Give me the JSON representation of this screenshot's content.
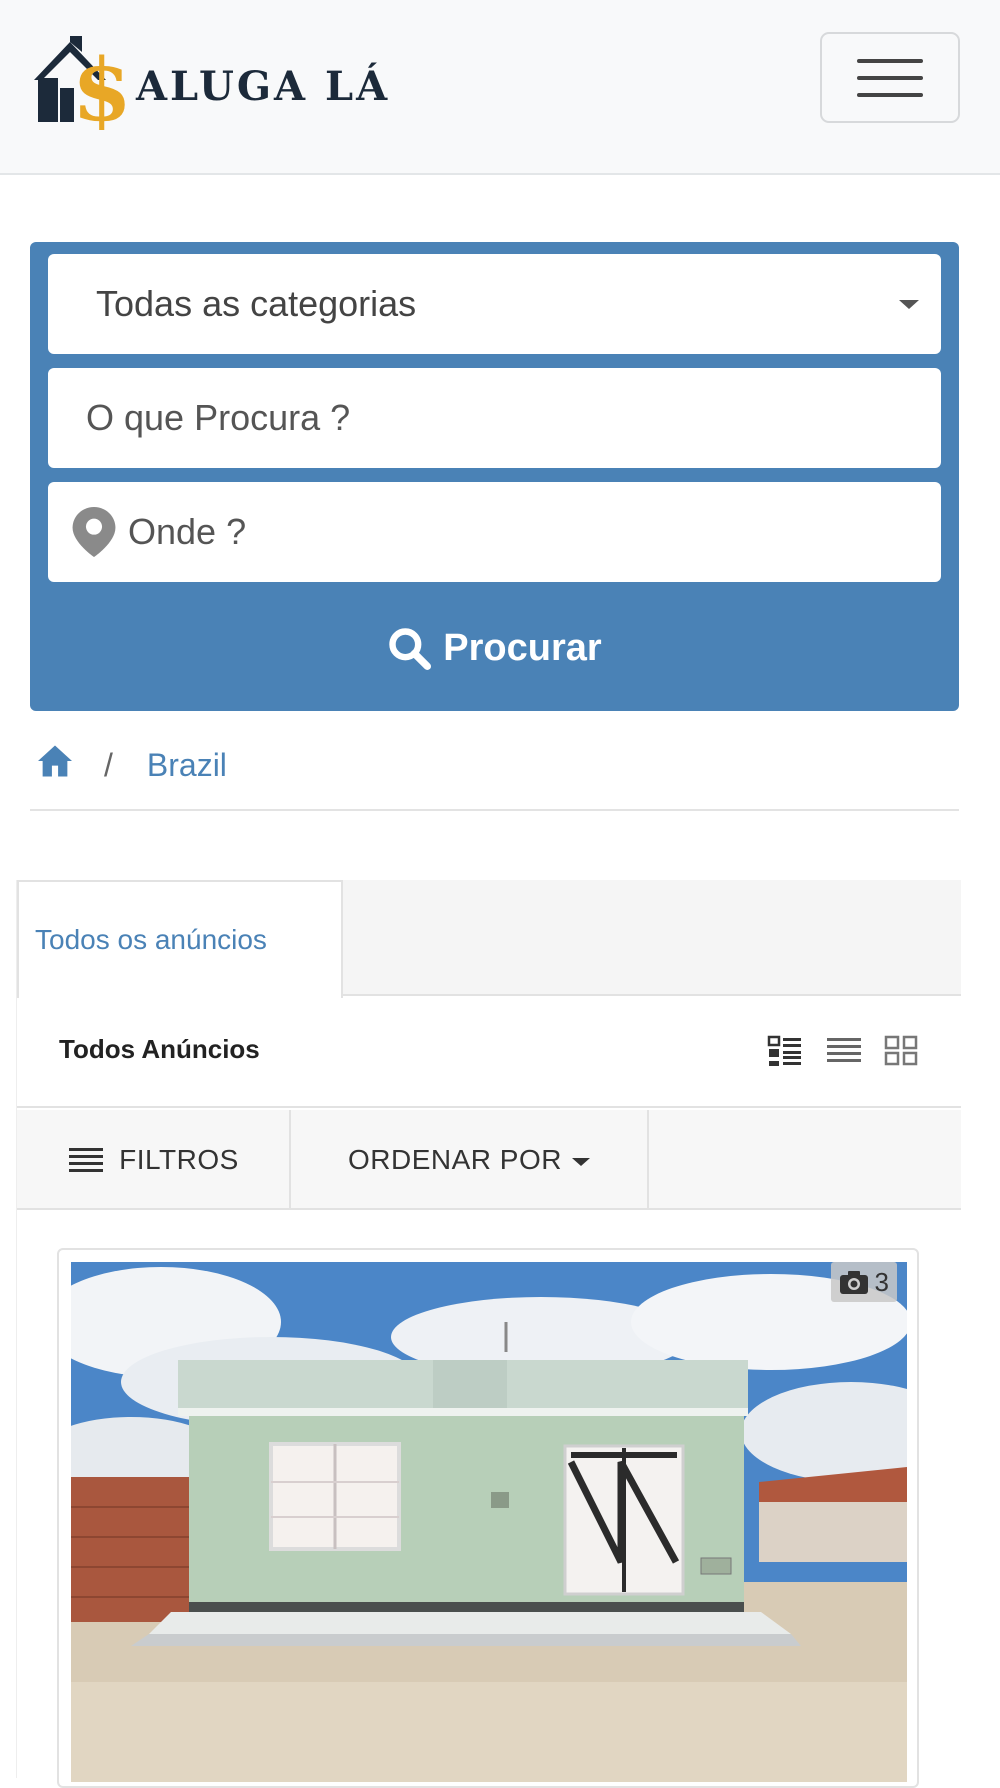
{
  "brand": {
    "name": "ALUGA LÁ",
    "logo_icon": "house-dollar-logo"
  },
  "navbar": {
    "menu_icon": "hamburger-menu-icon"
  },
  "search": {
    "category_selected": "Todas as categorias",
    "query_placeholder": "O que Procura ?",
    "location_placeholder": "Onde ?",
    "submit_label": "Procurar",
    "box_color": "#4a82b6"
  },
  "breadcrumb": {
    "home_icon": "home-icon",
    "separator": "/",
    "current": "Brazil"
  },
  "tabs": [
    {
      "label": "Todos os anúncios",
      "active": true
    }
  ],
  "listing_header": {
    "title": "Todos Anúncios",
    "view_icons": [
      "compact-list-icon",
      "list-view-icon",
      "grid-view-icon"
    ]
  },
  "filter_bar": {
    "filters_label": "FILTROS",
    "order_label": "ORDENAR POR"
  },
  "listings": [
    {
      "photo_count": "3",
      "photo_icon": "camera-icon"
    }
  ]
}
